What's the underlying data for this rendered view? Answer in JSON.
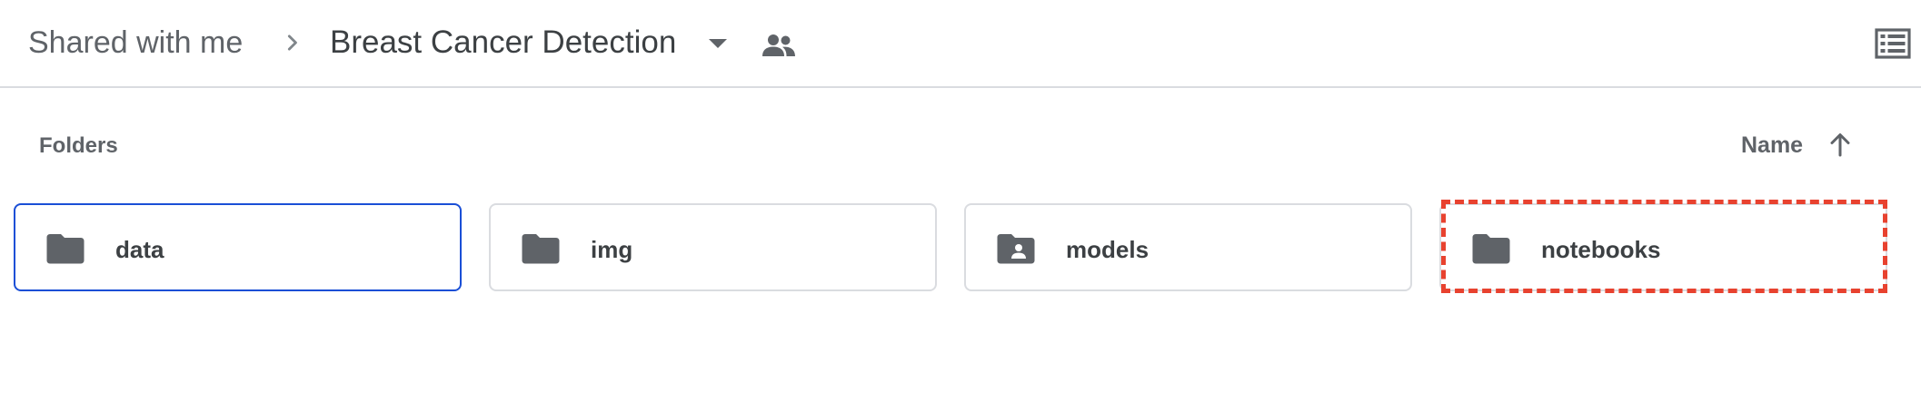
{
  "breadcrumb": {
    "root_label": "Shared with me",
    "current_label": "Breast Cancer Detection",
    "separator_icon": "chevron-right-icon",
    "dropdown_icon": "caret-down-icon",
    "shared_icon": "people-icon"
  },
  "toolbar": {
    "view_toggle_icon": "list-view-icon"
  },
  "section": {
    "title": "Folders",
    "sort_label": "Name",
    "sort_icon": "arrow-up-icon"
  },
  "folders": [
    {
      "name": "data",
      "icon": "folder-icon",
      "selected": true
    },
    {
      "name": "img",
      "icon": "folder-icon",
      "selected": false
    },
    {
      "name": "models",
      "icon": "shared-folder-icon",
      "selected": false
    },
    {
      "name": "notebooks",
      "icon": "folder-icon",
      "selected": false,
      "highlighted": true
    }
  ],
  "colors": {
    "selected_border": "#1a4fd6",
    "highlight": "#e8422f",
    "icon_gray": "#5f6368",
    "border_gray": "#dadce0"
  }
}
